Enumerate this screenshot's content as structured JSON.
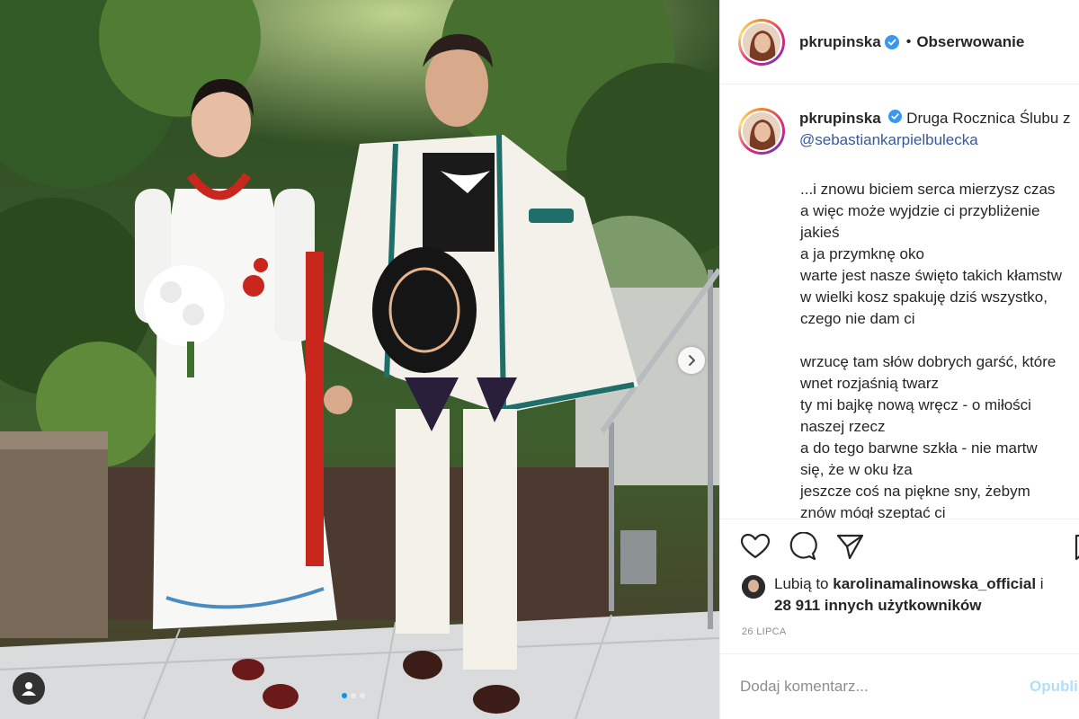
{
  "post": {
    "username": "pkrupinska",
    "follow_state": "Obserwowanie",
    "separator": "•",
    "caption_intro": "Druga Rocznica Ślubu z",
    "mention": "@sebastiankarpielbulecka",
    "poem_lines": [
      "...i znowu biciem serca mierzysz czas",
      "a więc może wyjdzie ci przybliżenie",
      "jakieś",
      "a ja przymknę oko",
      "warte jest nasze święto takich kłamstw",
      "w wielki kosz spakuję dziś wszystko,",
      "czego nie dam ci",
      "",
      "wrzucę tam słów dobrych garść, które",
      "wnet rozjaśnią twarz",
      "ty mi bajkę nową wręcz - o miłości",
      "naszej rzecz",
      "a do tego barwne szkła - nie martw",
      "się, że w oku łza",
      "jeszcze coś na piękne sny, żebym",
      "znów mógł szeptać ci"
    ],
    "likes_prefix": "Lubią to",
    "likes_user": "karolinamalinowska_official",
    "likes_and": "i",
    "likes_count": "28 911 innych użytkowników",
    "date": "26 LIPCA",
    "comment_placeholder": "Dodaj komentarz...",
    "post_button": "Opublikuj"
  },
  "carousel": {
    "slide_count": 3,
    "active_slide": 1
  },
  "icons": {
    "verified": "verified-badge-icon",
    "like": "heart-icon",
    "comment": "comment-icon",
    "share": "share-icon",
    "save": "bookmark-icon",
    "next": "chevron-right-icon",
    "tags": "user-tag-icon"
  },
  "colors": {
    "verified_blue": "#3897f0",
    "link_blue": "#385898",
    "post_button_disabled": "#b2dffc",
    "muted_text": "#8e8e8e",
    "active_dot": "#0095f6"
  }
}
